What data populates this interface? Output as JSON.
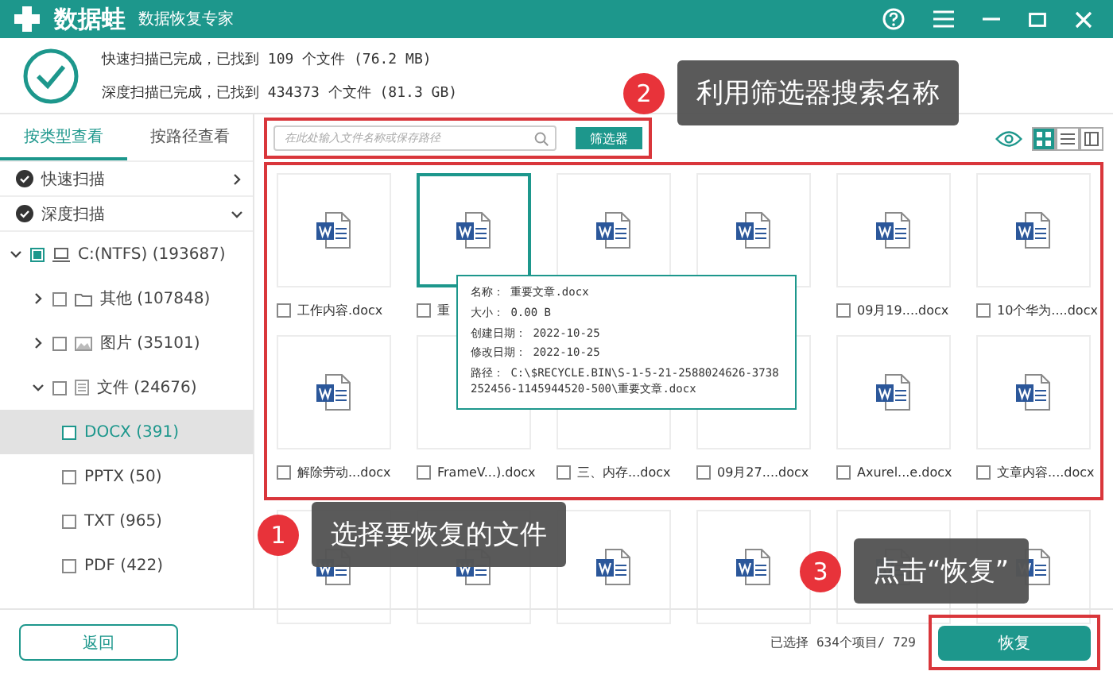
{
  "window": {
    "app_name": "数据蛙",
    "subtitle": "数据恢复专家"
  },
  "scan_summary": [
    "快速扫描已完成，已找到 109 个文件 (76.2 MB)",
    "深度扫描已完成，已找到 434373 个文件 (81.3 GB)"
  ],
  "view_tabs": [
    {
      "label": "按类型查看",
      "selected": true
    },
    {
      "label": "按路径查看",
      "selected": false
    }
  ],
  "tree": [
    {
      "label": "快速扫描",
      "kind": "scan",
      "expanded": false
    },
    {
      "label": "深度扫描",
      "kind": "scan",
      "expanded": true,
      "children": [
        {
          "label": "C:(NTFS) (193687)",
          "kind": "drive",
          "expanded": true,
          "checked": true,
          "selected": false,
          "children": [
            {
              "label": "其他 (107848)",
              "kind": "folder",
              "expanded": false,
              "checked": false,
              "selected": false
            },
            {
              "label": "图片 (35101)",
              "kind": "image",
              "expanded": false,
              "checked": false,
              "selected": false
            },
            {
              "label": "文件 (24676)",
              "kind": "doc",
              "expanded": true,
              "checked": false,
              "selected": false,
              "children": [
                {
                  "label": "DOCX (391)",
                  "checked": false,
                  "selected": true
                },
                {
                  "label": "PPTX (50)",
                  "checked": false,
                  "selected": false
                },
                {
                  "label": "TXT (965)",
                  "checked": false,
                  "selected": false
                },
                {
                  "label": "PDF (422)",
                  "checked": false,
                  "selected": false
                }
              ]
            }
          ]
        }
      ]
    }
  ],
  "search": {
    "placeholder": "在此处输入文件名称或保存路径"
  },
  "filter_button": "筛选器",
  "view_modes": [
    {
      "kind": "grid",
      "selected": true
    },
    {
      "kind": "list",
      "selected": false
    },
    {
      "kind": "detail",
      "selected": false
    }
  ],
  "files": [
    {
      "label": "工作内容.docx",
      "selected": false,
      "checked": false,
      "icon": true
    },
    {
      "label": "重",
      "selected": true,
      "checked": false,
      "icon": true
    },
    {
      "selected": false,
      "icon": true
    },
    {
      "selected": false,
      "icon": true
    },
    {
      "label": "09月19....docx",
      "selected": false,
      "checked": false,
      "icon": true
    },
    {
      "label": "10个华为....docx",
      "selected": false,
      "checked": false,
      "icon": true
    },
    {
      "label": "解除劳动...docx",
      "selected": false,
      "checked": false,
      "icon": true
    },
    {
      "label": "FrameV...).docx",
      "selected": false,
      "checked": false,
      "icon": false
    },
    {
      "label": "三、内存...docx",
      "selected": false,
      "checked": false,
      "icon": false
    },
    {
      "label": "09月27....docx",
      "selected": false,
      "checked": false,
      "icon": false
    },
    {
      "label": "Axurel...e.docx",
      "selected": false,
      "checked": false,
      "icon": true
    },
    {
      "label": "文章内容....docx",
      "selected": false,
      "checked": false,
      "icon": true
    },
    {
      "selected": false
    },
    {
      "selected": false
    },
    {
      "selected": false
    },
    {
      "selected": false
    },
    {
      "selected": false
    },
    {
      "selected": false
    }
  ],
  "tooltip": [
    {
      "label": "名称：",
      "value": "重要文章.docx"
    },
    {
      "label": "大小：",
      "value": "0.00 B"
    },
    {
      "label": "创建日期：",
      "value": "2022-10-25"
    },
    {
      "label": "修改日期：",
      "value": "2022-10-25"
    },
    {
      "label": "路径：",
      "value": "C:\\$RECYCLE.BIN\\S-1-5-21-2588024626-3738252456-1145944520-500\\重要文章.docx"
    }
  ],
  "callouts": [
    {
      "number": "2",
      "text": "利用筛选器搜索名称"
    },
    {
      "number": "1",
      "text": "选择要恢复的文件"
    },
    {
      "number": "3",
      "text": "点击“恢复”"
    }
  ],
  "footer": {
    "back_button": "返回",
    "status": "已选择 634个项目/ 729",
    "recover_button": "恢复"
  }
}
